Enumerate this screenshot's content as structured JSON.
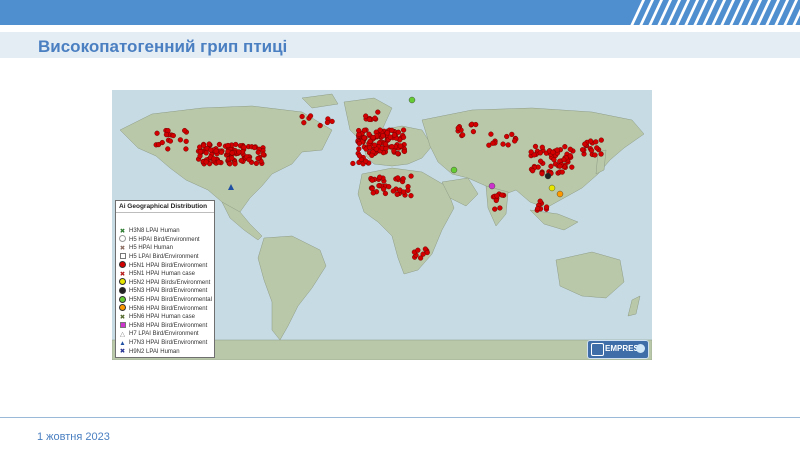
{
  "slide": {
    "title": "Високопатогенний грип птиці",
    "footer_date": "1 жовтня 2023"
  },
  "map": {
    "ocean_color": "#c6dbe4",
    "land_color": "#b9c8a8",
    "main_marker_color": "#d20000",
    "legend": {
      "title": "Ai Geographical Distribution",
      "items": [
        {
          "label": "H3N8 LPAI Human",
          "symbol": "cross",
          "color": "#2e7d32"
        },
        {
          "label": "H5 HPAI Bird/Environment",
          "symbol": "circle-outline",
          "color": "#999999"
        },
        {
          "label": "H5 HPAI Human",
          "symbol": "cross",
          "color": "#8d6e63"
        },
        {
          "label": "H5 LPAI Bird/Environment",
          "symbol": "square-outline",
          "color": "#999999"
        },
        {
          "label": "H5N1 HPAI Bird/Environment",
          "symbol": "circle",
          "color": "#d20000"
        },
        {
          "label": "H5N1 HPAI Human case",
          "symbol": "cross",
          "color": "#b71c1c"
        },
        {
          "label": "H5N2 HPAI Birds/Environment",
          "symbol": "circle",
          "color": "#e6e600"
        },
        {
          "label": "H5N3 HPAI Bird/Environment",
          "symbol": "circle",
          "color": "#222222"
        },
        {
          "label": "H5N5 HPAI Bird/Environmental",
          "symbol": "circle",
          "color": "#66cc33"
        },
        {
          "label": "H5N6 HPAI Bird/Environment",
          "symbol": "circle",
          "color": "#ff9900"
        },
        {
          "label": "H5N6 HPAI Human case",
          "symbol": "cross",
          "color": "#556b2f"
        },
        {
          "label": "H5N8 HPAI Bird/Environment",
          "symbol": "square",
          "color": "#cc33cc"
        },
        {
          "label": "H7 LPAI Bird/Environment",
          "symbol": "triangle-outline",
          "color": "#777777"
        },
        {
          "label": "H7N3 HPAI Bird/Environment",
          "symbol": "triangle",
          "color": "#1f4fa3"
        },
        {
          "label": "H9N2 LPAI Human",
          "symbol": "cross",
          "color": "#283593"
        }
      ]
    },
    "badge_label": "EMPRES"
  }
}
